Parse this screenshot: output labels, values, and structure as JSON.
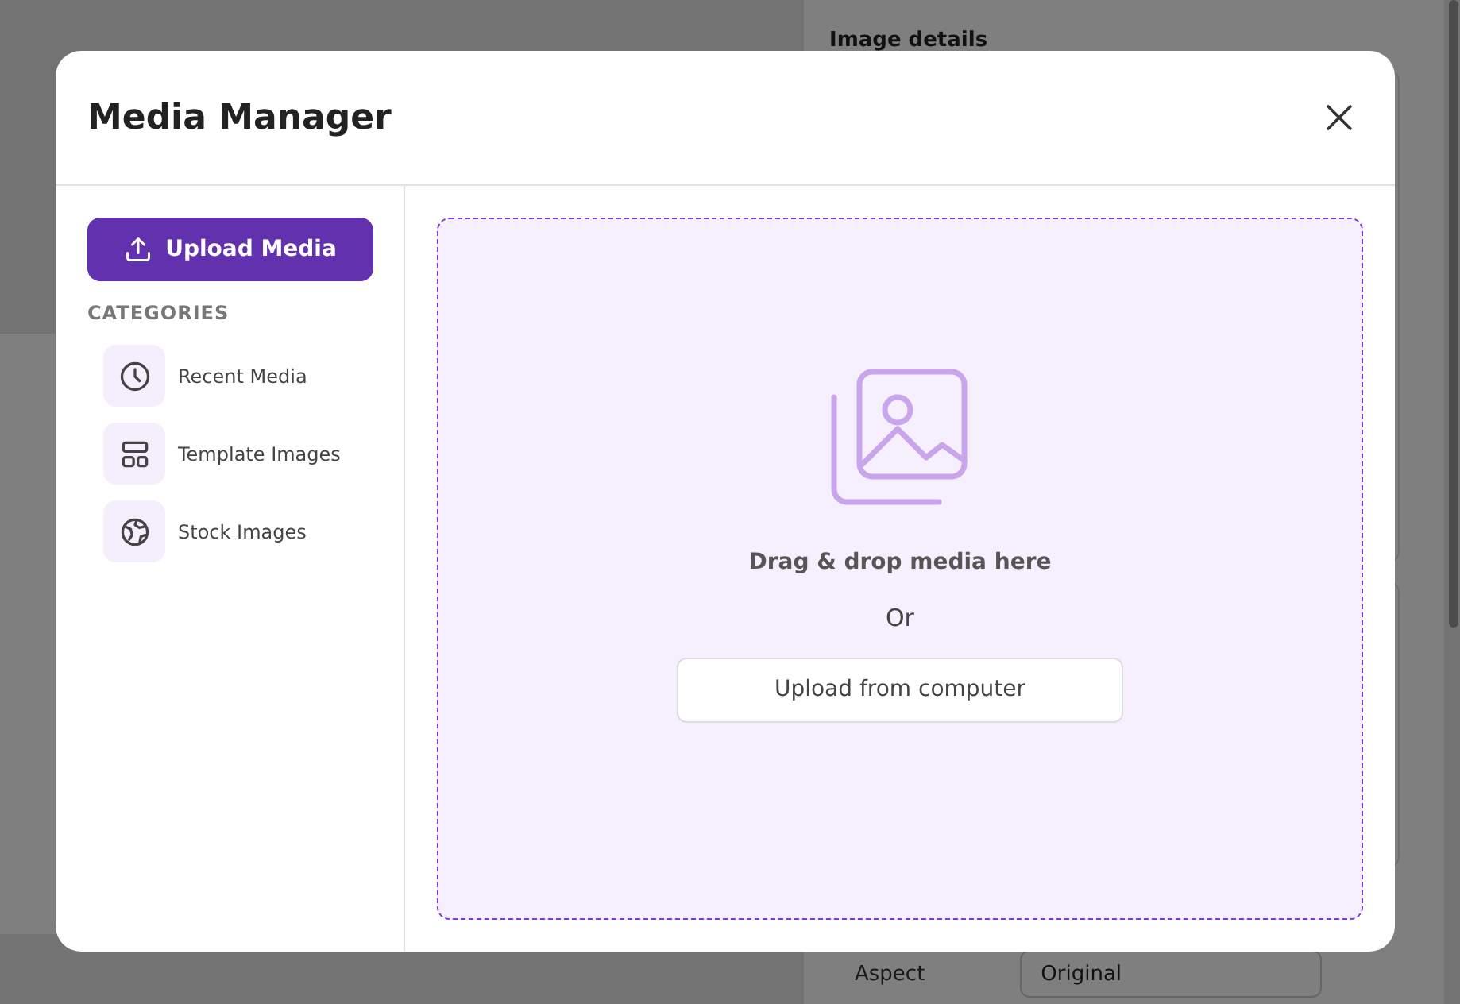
{
  "background": {
    "panel_title": "Image details",
    "aspect_label": "Aspect",
    "aspect_value": "Original"
  },
  "modal": {
    "title": "Media Manager",
    "upload_button": "Upload Media",
    "categories_heading": "CATEGORIES",
    "categories": [
      {
        "kind": "clock",
        "label": "Recent Media",
        "selected": false
      },
      {
        "kind": "layout",
        "label": "Template Images",
        "selected": false
      },
      {
        "kind": "globe",
        "label": "Stock Images",
        "selected": false
      }
    ],
    "dropzone": {
      "heading": "Drag & drop media here",
      "separator": "Or",
      "button": "Upload from computer"
    }
  }
}
